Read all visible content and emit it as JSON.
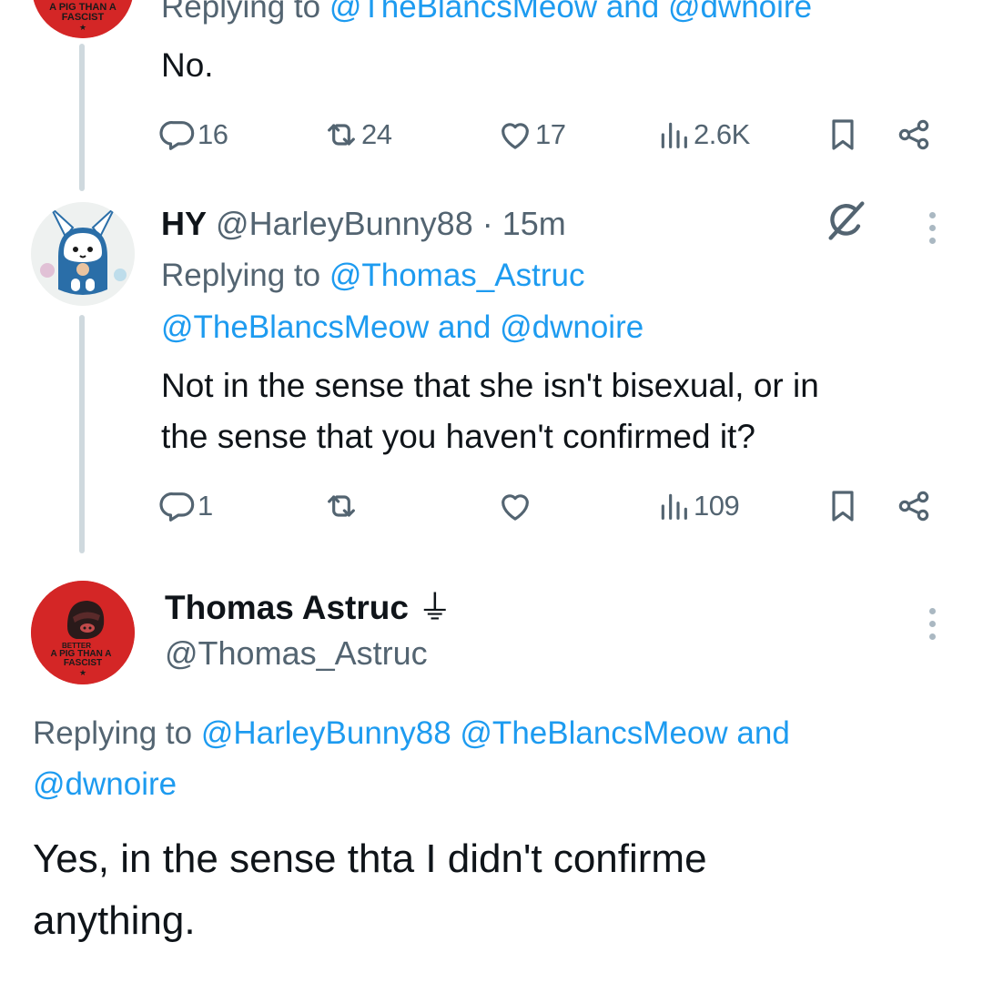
{
  "tweet1": {
    "replying_prefix": "Replying to",
    "replying_handles": "@TheBlancsMeow and @dwnoire",
    "text": "No.",
    "stats": {
      "replies": "16",
      "reposts": "24",
      "likes": "17",
      "views": "2.6K"
    },
    "avatar": {
      "caption_line1": "A PIG THAN A",
      "caption_line2": "FASCIST"
    }
  },
  "tweet2": {
    "name": "HY",
    "handle": "@HarleyBunny88",
    "separator": "·",
    "time": "15m",
    "replying_prefix": "Replying to",
    "replying_line1": "@Thomas_Astruc",
    "replying_line2": "@TheBlancsMeow and @dwnoire",
    "text_line1": "Not in the sense that she isn't bisexual, or in",
    "text_line2": "the sense that you haven't confirmed it?",
    "stats": {
      "replies": "1",
      "reposts": "",
      "likes": "",
      "views": "109"
    },
    "badge_icon": "grok-icon"
  },
  "tweet3": {
    "name": "Thomas Astruc",
    "name_emoji": "⏚",
    "handle": "@Thomas_Astruc",
    "replying_prefix": "Replying to",
    "replying_line1_handles": "@HarleyBunny88 @TheBlancsMeow and",
    "replying_line2": "@dwnoire",
    "text_line1": "Yes, in the sense thta I didn't confirme",
    "text_line2": "anything.",
    "avatar": {
      "caption_line1": "BETTER",
      "caption_line2": "A PIG THAN A",
      "caption_line3": "FASCIST"
    }
  },
  "icons": {
    "reply": "reply-icon",
    "repost": "repost-icon",
    "like": "heart-icon",
    "views": "views-icon",
    "bookmark": "bookmark-icon",
    "share": "share-icon",
    "more": "more-icon"
  },
  "colors": {
    "link": "#1d9bf0",
    "muted": "#536471",
    "text": "#0f1419",
    "avatar_red": "#d42626",
    "thread_line": "#cfd9de"
  }
}
